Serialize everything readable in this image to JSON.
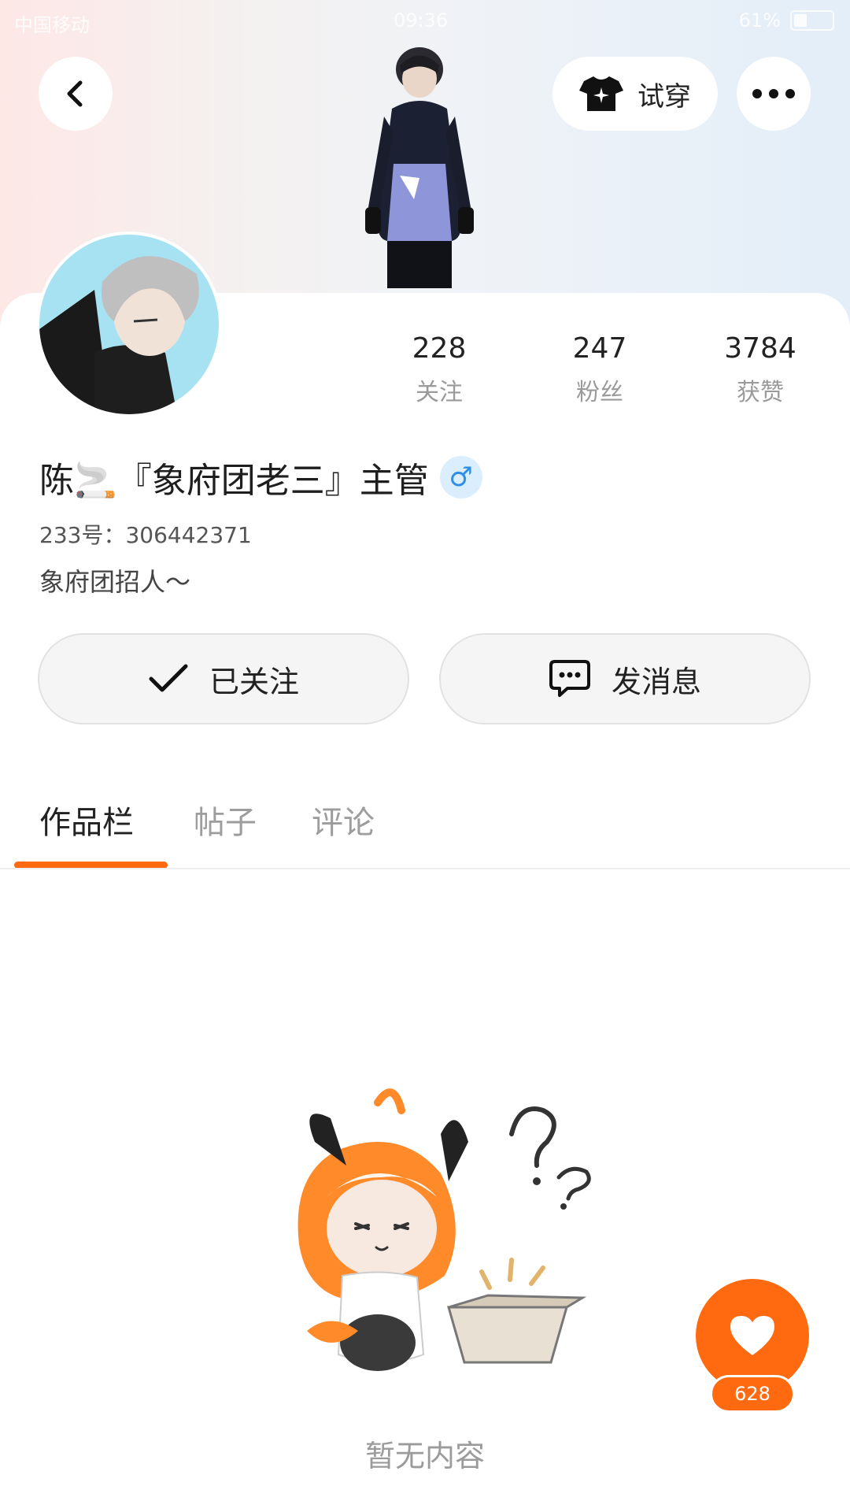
{
  "status_bar": {
    "carrier": "中国移动",
    "time": "09:36",
    "battery": "61%"
  },
  "header": {
    "try_on_label": "试穿"
  },
  "profile": {
    "stats": [
      {
        "value": "228",
        "label": "关注"
      },
      {
        "value": "247",
        "label": "粉丝"
      },
      {
        "value": "3784",
        "label": "获赞"
      }
    ],
    "nickname": "陈🚬『象府团老三』主管",
    "gender_symbol": "♂",
    "account_id": "233号：306442371",
    "bio": "象府团招人～"
  },
  "actions": {
    "follow_label": "已关注",
    "message_label": "发消息"
  },
  "tabs": [
    {
      "label": "作品栏",
      "active": true
    },
    {
      "label": "帖子",
      "active": false
    },
    {
      "label": "评论",
      "active": false
    }
  ],
  "empty_state": {
    "text": "暂无内容"
  },
  "like_fab": {
    "count": "628"
  },
  "colors": {
    "accent": "#ff6a10",
    "gender": "#2f8fe6"
  }
}
